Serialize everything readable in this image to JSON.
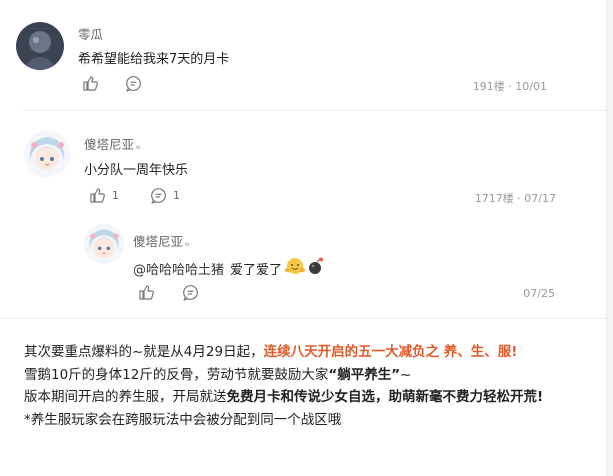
{
  "comments": [
    {
      "name": "零瓜",
      "text": "希希望能给我来7天的月卡",
      "meta": "191楼 · 10/01",
      "like_count": "",
      "reply_count": ""
    },
    {
      "name": "傻塔尼亚",
      "level": "ℴ",
      "text": "小分队一周年快乐",
      "meta": "1717楼 · 07/17",
      "like_count": "1",
      "reply_count": "1",
      "reply": {
        "name": "傻塔尼亚",
        "level": "ℴ",
        "mention": "@哈哈哈哈土猪",
        "text": "爱了爱了",
        "meta": "07/25"
      }
    }
  ],
  "article": {
    "line1_pre": "其次要重点爆料的~就是从4月29日起，",
    "line1_highlight": "连续八天开启的五一大减负之 养、生、服!",
    "line2_pre": "雪鹅10斤的身体12斤的反骨，劳动节就要鼓励大家",
    "line2_bold": "“躺平养生”",
    "line2_post": "~",
    "line3_pre": "版本期间开启的养生服，开局就送",
    "line3_bold": "免费月卡和传说少女自选，助萌新毫不费力轻松开荒!",
    "line4": "*养生服玩家会在跨服玩法中会被分配到同一个战区哦"
  },
  "colors": {
    "highlight": "#e05a2a",
    "meta_gray": "#999999",
    "divider": "#eeeeee"
  }
}
